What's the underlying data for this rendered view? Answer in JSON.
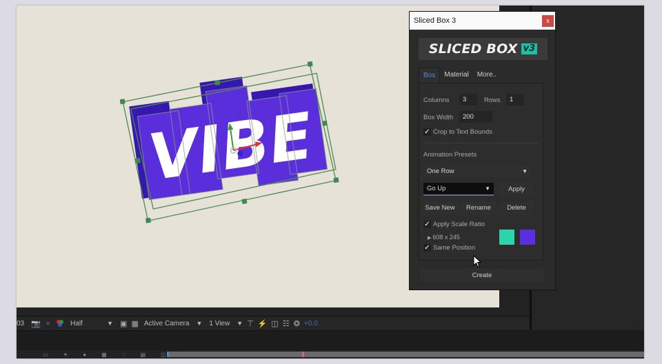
{
  "dialog": {
    "title": "Sliced Box 3",
    "close_label": "x",
    "logo_text": "SLICED BOX",
    "logo_badge": "v3",
    "tabs": [
      {
        "label": "Box",
        "active": true
      },
      {
        "label": "Material",
        "active": false
      },
      {
        "label": "More..",
        "active": false
      }
    ],
    "columns_label": "Columns",
    "columns_value": "3",
    "rows_label": "Rows",
    "rows_value": "1",
    "box_width_label": "Box Width",
    "box_width_value": "200",
    "crop_label": "Crop to Text Bounds",
    "crop_checked": true,
    "animation_presets_label": "Animation Presets",
    "preset_group": "One Row",
    "preset_selected": "Go Up",
    "apply_label": "Apply",
    "save_new_label": "Save New",
    "rename_label": "Rename",
    "delete_label": "Delete",
    "apply_scale_label": "Apply Scale Ratio",
    "apply_scale_checked": true,
    "dimensions": "608 x 245",
    "same_position_label": "Same Position",
    "same_position_checked": true,
    "color_front": "#2dd4aa",
    "color_side": "#5a2fe0",
    "create_label": "Create"
  },
  "viewer": {
    "text": "VIBE",
    "box_color": "#5a2ad8",
    "box_dark_color": "#3a18b0"
  },
  "viewer_toolbar": {
    "frame_suffix": "03",
    "camera_icon": "camera-icon",
    "resolution": "Half",
    "camera": "Active Camera",
    "views": "1 View",
    "exposure": "+0.0"
  },
  "top_panel": {
    "unit": "px"
  }
}
